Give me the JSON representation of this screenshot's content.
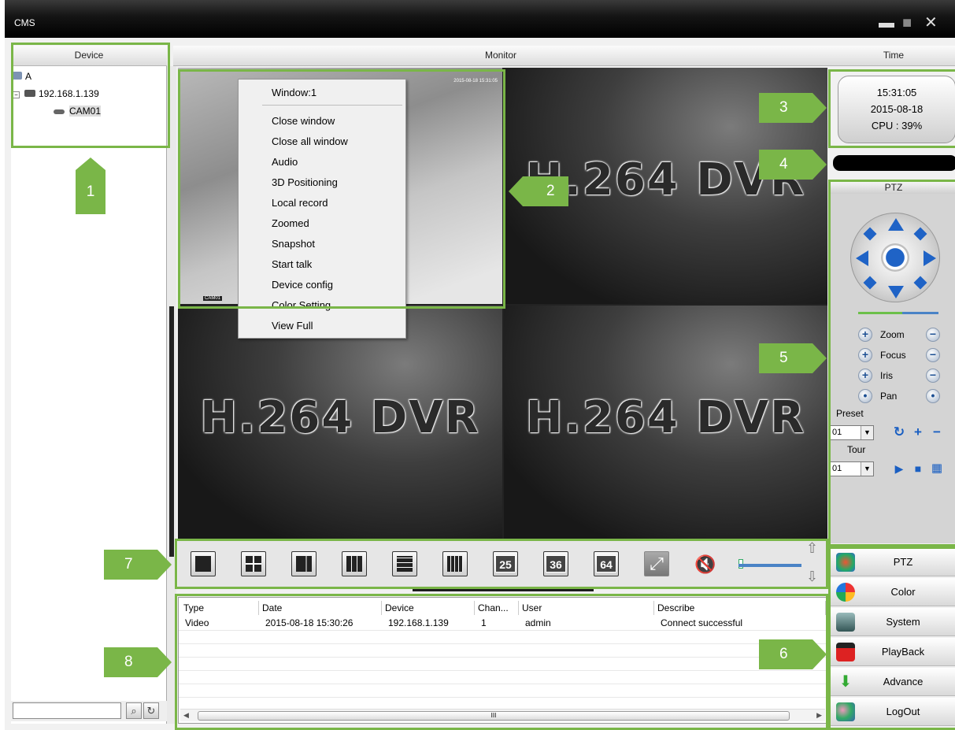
{
  "window": {
    "title": "CMS",
    "min": "▬",
    "max": "■",
    "close": "✕"
  },
  "headers": {
    "device": "Device",
    "monitor": "Monitor",
    "time": "Time"
  },
  "tree": {
    "root": "A",
    "device": "192.168.1.139",
    "camera": "CAM01"
  },
  "search": {
    "value": ""
  },
  "video": {
    "watermark": "H.264 DVR",
    "live_stamp": "2015-08-18 15:31:05",
    "live_cam": "CAM01"
  },
  "context_menu": {
    "items": [
      "Window:1",
      "Close window",
      "Close all window",
      "Audio",
      "3D Positioning",
      "Local record",
      "Zoomed",
      "Snapshot",
      "Start talk",
      "Device config",
      "Color Setting",
      "View Full"
    ]
  },
  "clock": {
    "time": "15:31:05",
    "date": "2015-08-18",
    "cpu": "CPU : 39%"
  },
  "ptz": {
    "title": "PTZ",
    "rows": [
      "Zoom",
      "Focus",
      "Iris",
      "Pan"
    ],
    "preset_label": "Preset",
    "preset_value": "01",
    "tour_label": "Tour",
    "tour_value": "01"
  },
  "nav": {
    "items": [
      "PTZ",
      "Color",
      "System",
      "PlayBack",
      "Advance",
      "LogOut"
    ]
  },
  "layouts": {
    "numbers": [
      "25",
      "36",
      "64"
    ]
  },
  "log": {
    "columns": [
      "Type",
      "Date",
      "Device",
      "Chan...",
      "User",
      "Describe"
    ],
    "rows": [
      [
        "Video",
        "2015-08-18 15:30:26",
        "192.168.1.139",
        "1",
        "admin",
        "Connect successful"
      ]
    ],
    "scroll_mark": "III"
  },
  "callouts": [
    "1",
    "2",
    "3",
    "4",
    "5",
    "6",
    "7",
    "8"
  ],
  "colors": {
    "highlight": "#7ab648",
    "accent": "#1a5fc2"
  }
}
